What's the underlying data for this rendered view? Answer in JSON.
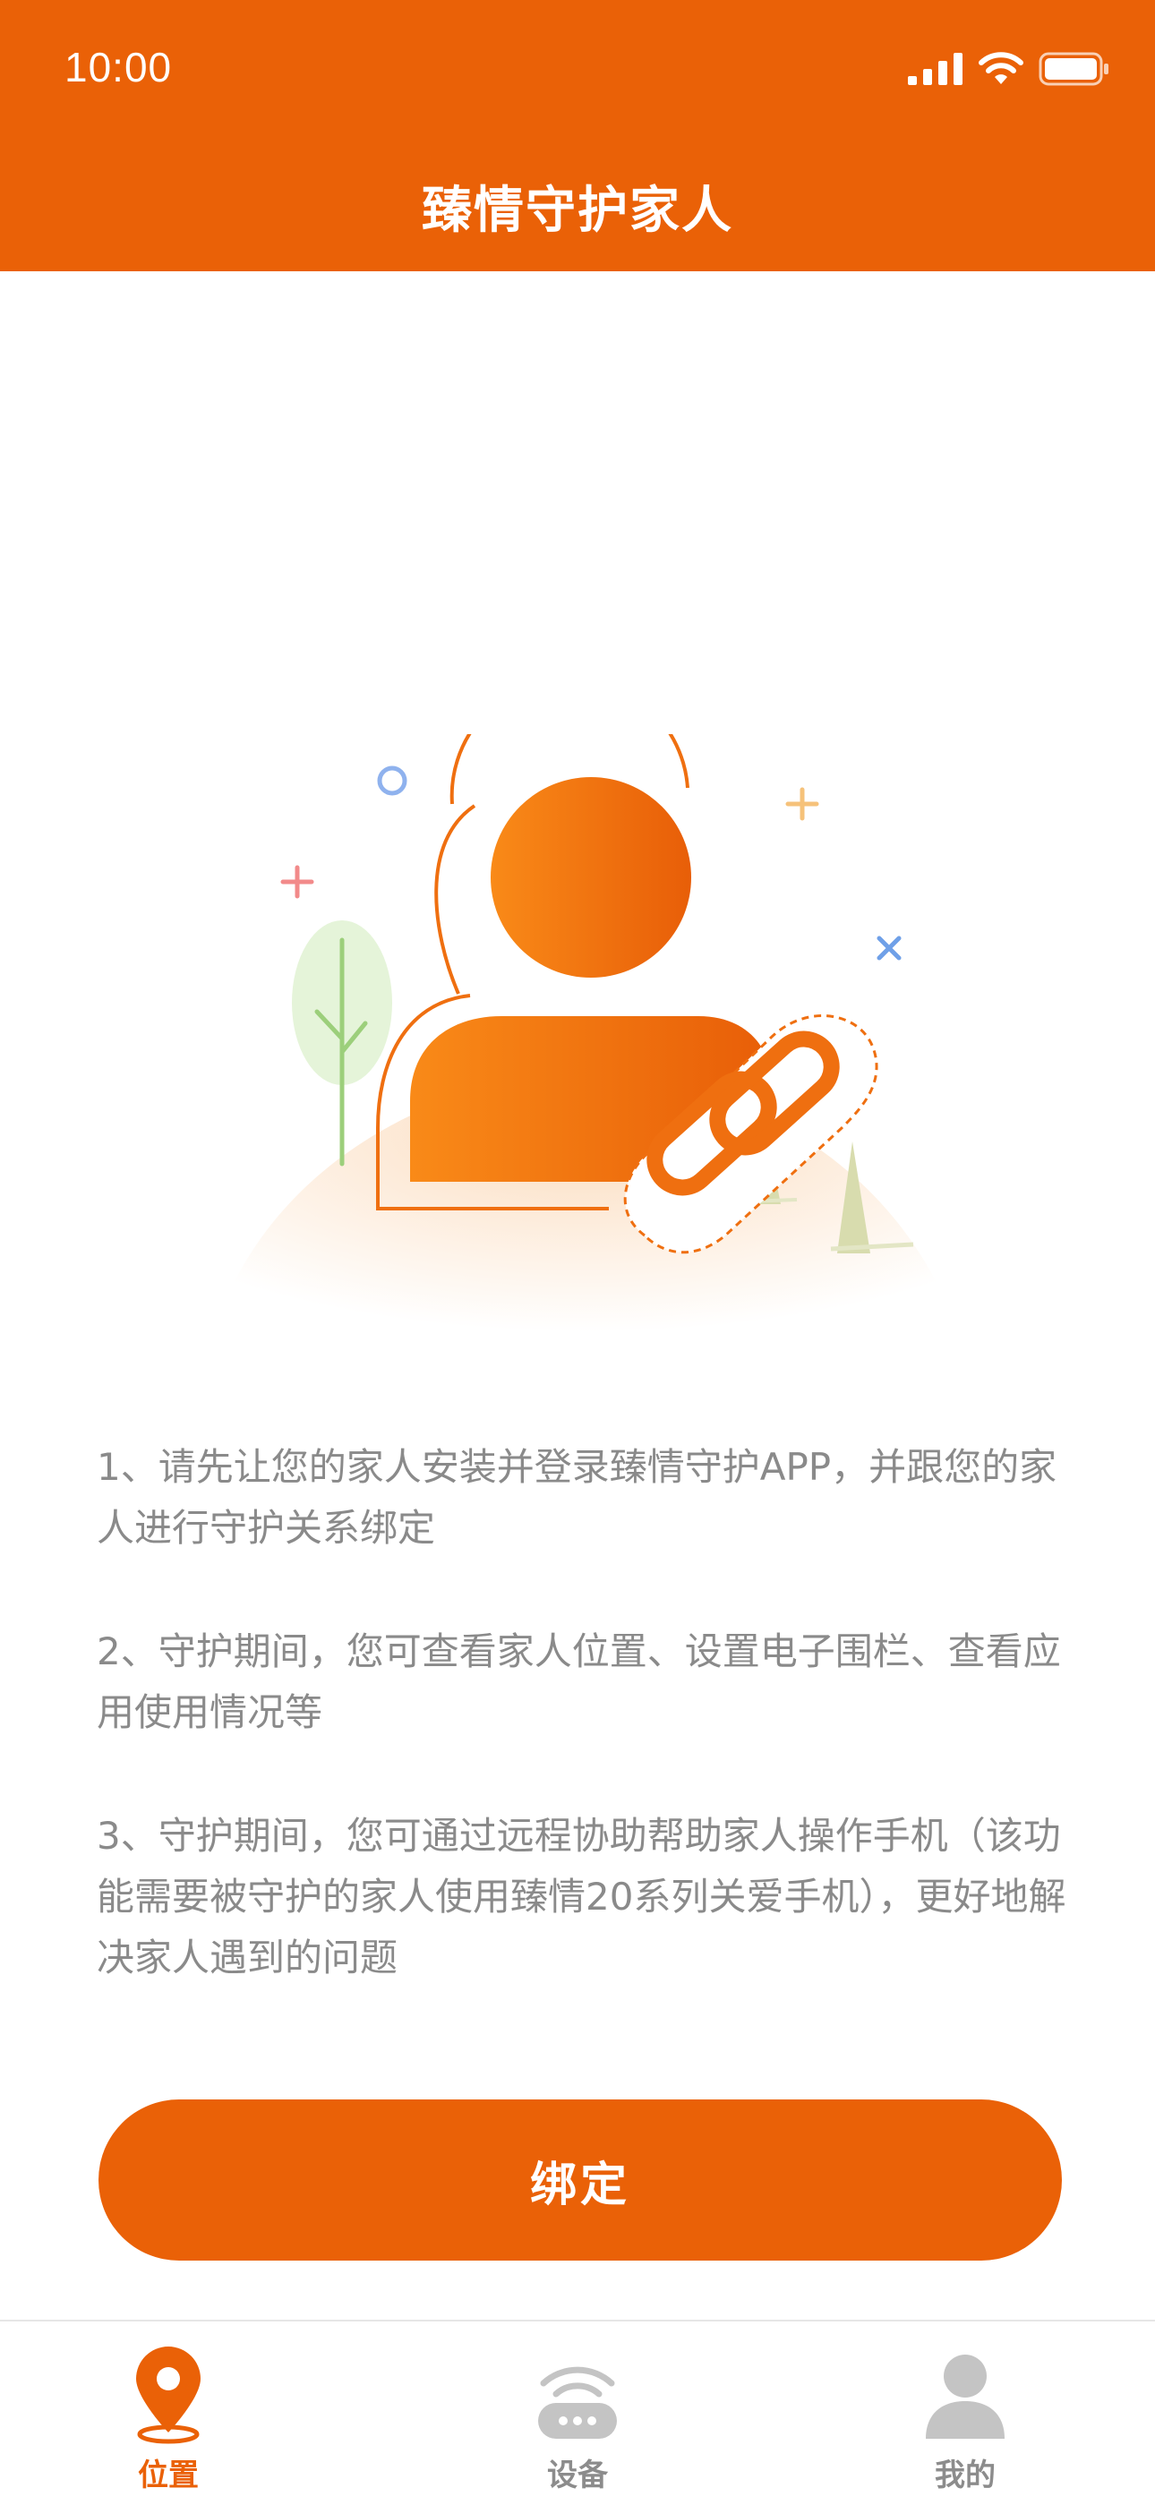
{
  "status_bar": {
    "time": "10:00"
  },
  "header": {
    "title": "臻情守护家人"
  },
  "instructions": [
    "1、请先让您的家人安装并登录臻情守护APP，并跟您的家人进行守护关系绑定",
    "2、守护期间，您可查看家人位置、设置电子围栏、查看应用使用情况等",
    "3、守护期间，您可通过远程协助帮助家人操作手机（该功能需要被守护的家人使用臻情20系列关爱手机），更好地解决家人遇到的问题"
  ],
  "bind_button": {
    "label": "绑定"
  },
  "tabbar": {
    "items": [
      {
        "label": "位置",
        "icon": "location-pin-icon",
        "active": true
      },
      {
        "label": "设备",
        "icon": "device-wifi-icon",
        "active": false
      },
      {
        "label": "我的",
        "icon": "person-icon",
        "active": false
      }
    ]
  },
  "colors": {
    "accent": "#ea6107",
    "text_muted": "#8a8a8a",
    "inactive": "#c4c4c4"
  }
}
